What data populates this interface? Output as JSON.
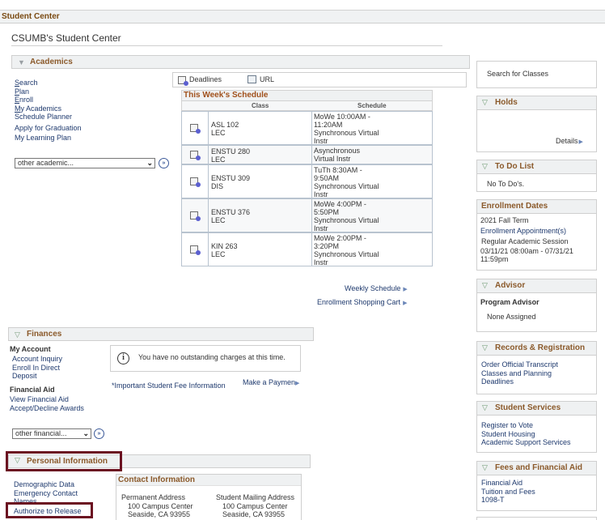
{
  "header": {
    "title": "Student Center"
  },
  "page_title": "CSUMB's Student Center",
  "academics": {
    "title": "Academics",
    "links": [
      "Search",
      "Plan",
      "Enroll",
      "My Academics",
      "Schedule Planner",
      "Apply for Graduation",
      "My Learning Plan"
    ],
    "select_value": "other academic...",
    "deadlines_label": "Deadlines",
    "url_label": "URL",
    "schedule": {
      "title": "This Week's Schedule",
      "columns": [
        "Class",
        "Schedule"
      ],
      "rows": [
        {
          "class": [
            "ASL 102",
            "LEC"
          ],
          "schedule": [
            "MoWe 10:00AM -",
            "11:20AM",
            "Synchronous Virtual",
            "Instr"
          ]
        },
        {
          "class": [
            "ENSTU 280",
            "LEC"
          ],
          "schedule": [
            "Asynchronous",
            "Virtual Instr"
          ]
        },
        {
          "class": [
            "ENSTU 309",
            "DIS"
          ],
          "schedule": [
            "TuTh 8:30AM -",
            "9:50AM",
            "Synchronous Virtual",
            "Instr"
          ]
        },
        {
          "class": [
            "ENSTU 376",
            "LEC"
          ],
          "schedule": [
            "MoWe 4:00PM -",
            "5:50PM",
            "Synchronous Virtual",
            "Instr"
          ]
        },
        {
          "class": [
            "KIN 263",
            "LEC"
          ],
          "schedule": [
            "MoWe 2:00PM -",
            "3:20PM",
            "Synchronous Virtual",
            "Instr"
          ]
        }
      ]
    },
    "weekly_schedule": "Weekly Schedule",
    "shopping_cart": "Enrollment Shopping Cart"
  },
  "finances": {
    "title": "Finances",
    "my_account_heading": "My Account",
    "my_account_links": [
      "Account Inquiry",
      "Enroll In Direct",
      "Deposit"
    ],
    "financial_aid_heading": "Financial Aid",
    "financial_aid_links": [
      "View Financial Aid",
      "Accept/Decline Awards"
    ],
    "notice": "You have no outstanding charges at this time.",
    "fee_info": "*Important Student Fee Information",
    "make_payment": "Make a Paymen",
    "select_value": "other financial..."
  },
  "personal": {
    "title": "Personal Information",
    "links": [
      "Demographic Data",
      "Emergency Contact",
      "Names",
      "Authorize to Release"
    ],
    "contact_title": "Contact Information",
    "permanent": {
      "label": "Permanent Address",
      "line1": "100 Campus Center",
      "line2": "Seaside, CA 93955"
    },
    "mailing": {
      "label": "Student Mailing Address",
      "line1": "100 Campus Center",
      "line2": "Seaside, CA 93955"
    }
  },
  "sidebar": {
    "search_classes": "Search for Classes",
    "holds": {
      "title": "Holds",
      "details": "Details"
    },
    "todo": {
      "title": "To Do List",
      "text": "No To Do's."
    },
    "enrollment": {
      "title": "Enrollment Dates",
      "term": "2021 Fall Term",
      "appointments": "Enrollment Appointment(s)",
      "session": "Regular Academic Session",
      "range1": "03/11/21 08:00am - 07/31/21",
      "range2": "11:59pm"
    },
    "advisor": {
      "title": "Advisor",
      "label": "Program Advisor",
      "value": "None Assigned"
    },
    "records": {
      "title": "Records & Registration",
      "links": [
        "Order Official Transcript",
        "Classes and Planning",
        "Deadlines"
      ]
    },
    "services": {
      "title": "Student Services",
      "links": [
        "Register to Vote",
        "Student Housing",
        "Academic Support Services"
      ]
    },
    "fees": {
      "title": "Fees and Financial Aid",
      "links": [
        "Financial Aid",
        "Tuition and Fees",
        "1098-T"
      ]
    }
  }
}
